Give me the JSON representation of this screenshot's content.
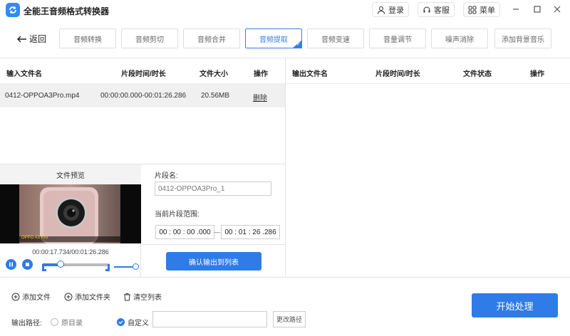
{
  "app": {
    "title": "全能王音频格式转换器"
  },
  "titlebar": {
    "login": "登录",
    "service": "客服",
    "menu": "菜单"
  },
  "toolbar": {
    "back": "返回",
    "tabs": [
      "音频转换",
      "音频剪切",
      "音频合并",
      "音频提取",
      "音频变速",
      "音量调节",
      "噪声消除",
      "添加背景音乐"
    ],
    "active_tab": "音频提取"
  },
  "input_table": {
    "headers": [
      "输入文件名",
      "片段时间/时长",
      "文件大小",
      "操作"
    ],
    "rows": [
      {
        "name": "0412-OPPOA3Pro.mp4",
        "time": "00:00:00.000-00:01:26.286",
        "size": "20.56MB",
        "action": "删除"
      }
    ]
  },
  "output_table": {
    "headers": [
      "输出文件名",
      "片段时间/时长",
      "文件状态",
      "操作"
    ]
  },
  "preview": {
    "title": "文件预览",
    "current_time": "00:00:17.734/00:01:26.286",
    "caption": "OPPO A3 Pro"
  },
  "segment": {
    "name_label": "片段名:",
    "name_value": "0412-OPPOA3Pro_1",
    "range_label": "当前片段范围:",
    "start": "00 : 00 : 00 .000",
    "end": "00 : 01 : 26 .286",
    "confirm": "确认输出到列表"
  },
  "bottom": {
    "add_file": "添加文件",
    "add_folder": "添加文件夹",
    "clear_list": "清空列表",
    "output_path_label": "输出路径:",
    "option_original": "原目录",
    "option_custom": "自定义",
    "change_path": "更改路径",
    "start": "开始处理"
  },
  "colors": {
    "accent": "#2f7be8",
    "active_tab": "#3a7de6"
  }
}
